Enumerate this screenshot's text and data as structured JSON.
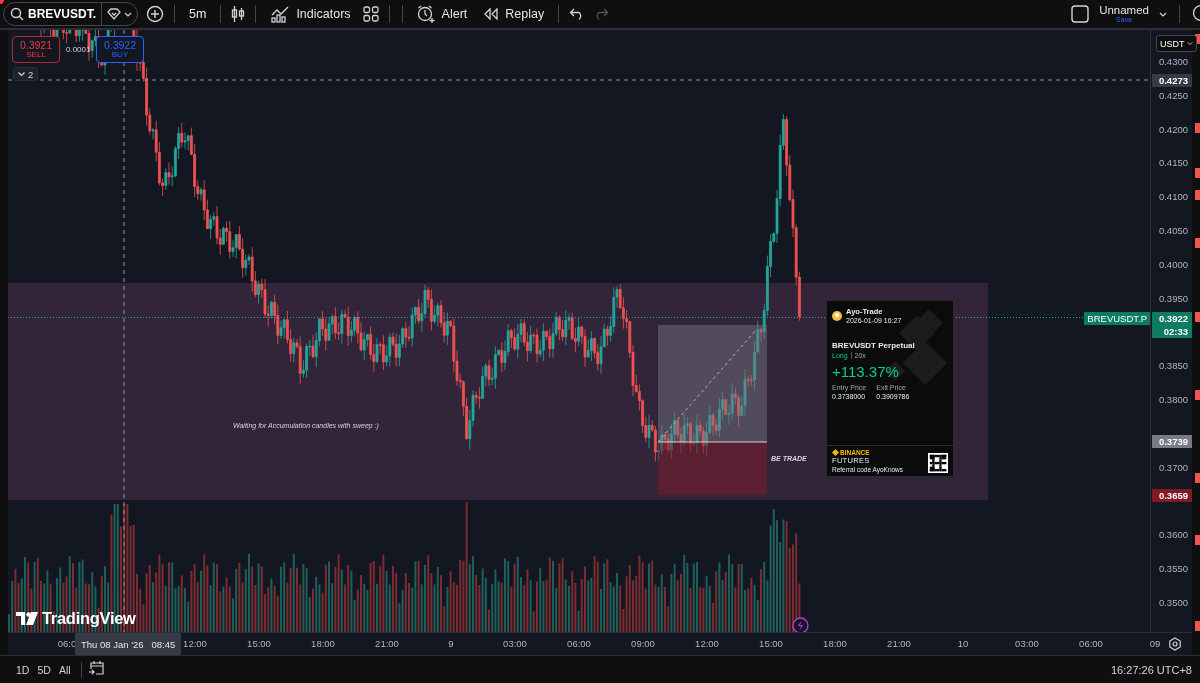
{
  "toolbar": {
    "symbol": "BREVUSDT.",
    "interval": "5m",
    "buttons": [
      {
        "label": "Indicators",
        "kind": "indicators"
      },
      {
        "label": "Alert",
        "kind": "alert"
      },
      {
        "label": "Replay",
        "kind": "replay"
      }
    ],
    "undo_disabled": false,
    "redo_disabled": true,
    "layout": {
      "name": "Unnamed",
      "action": "Save"
    }
  },
  "trade_buttons": {
    "sell": {
      "price": "0.3921",
      "label": "SELL"
    },
    "spread": "0.0001",
    "buy": {
      "price": "0.3922",
      "label": "BUY"
    }
  },
  "collapse_count": "2",
  "chart": {
    "currency": "USDT",
    "price_scale": [
      "0.4300",
      "0.4250",
      "0.4200",
      "0.4150",
      "0.4100",
      "0.4050",
      "0.4000",
      "0.3950",
      "0.3850",
      "0.3800",
      "0.3700",
      "0.3600",
      "0.3550",
      "0.3500"
    ],
    "markers": [
      {
        "kind": "high",
        "price": "0.4273"
      },
      {
        "kind": "last",
        "symbol": "BREVUSDT.P",
        "price": "0.3922",
        "countdown": "02:33"
      },
      {
        "kind": "entry",
        "price": "0.3739"
      },
      {
        "kind": "stop",
        "price": "0.3659"
      }
    ],
    "notes": [
      {
        "kind": "zone",
        "text": "Waiting for Accumulation candles with sweep :)"
      },
      {
        "kind": "trade",
        "text": "BE TRADE"
      }
    ],
    "time_labels": [
      "06:0",
      "12:00",
      "15:00",
      "18:00",
      "21:00",
      "9",
      "03:00",
      "06:00",
      "09:00",
      "12:00",
      "15:00",
      "18:00",
      "21:00",
      "10",
      "03:00",
      "06:00",
      "09"
    ],
    "crosshair": {
      "date": "Thu 08 Jan '26",
      "time": "08:45"
    },
    "brand": "TradingView"
  },
  "pnl_card": {
    "user": "Ayo-Trade",
    "timestamp": "2026-01-09 16:27",
    "contract": "BREVUSDT Perpetual",
    "side": "Long",
    "leverage": "20x",
    "roi": "+113.37%",
    "prices": [
      {
        "label": "Entry Price",
        "value": "0.3738000"
      },
      {
        "label": "Exit Price",
        "value": "0.3909786"
      }
    ],
    "exchange": "BINANCE",
    "product": "FUTURES",
    "referral": "Referral code AyoKnows"
  },
  "bottom_bar": {
    "ranges": [
      {
        "label": "1D"
      },
      {
        "label": "5D"
      },
      {
        "label": "All"
      }
    ],
    "clock": "16:27:26 UTC+8"
  }
}
